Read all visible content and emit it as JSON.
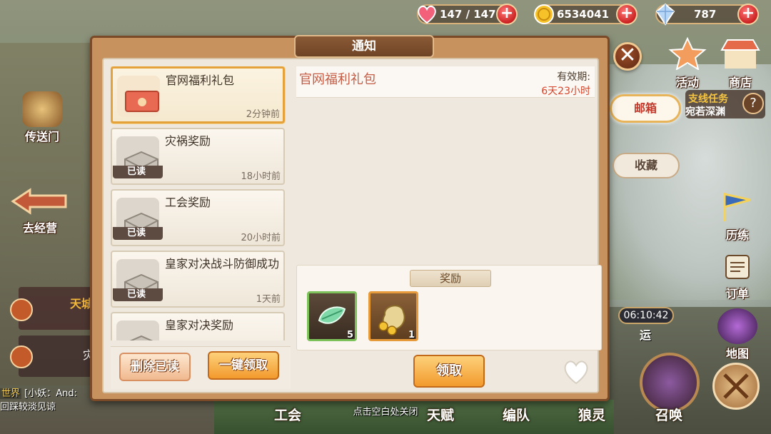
{
  "hud": {
    "stamina": {
      "icon": "heart-icon",
      "value": "147 / 147"
    },
    "gold": {
      "icon": "coin-icon",
      "value": "6534041"
    },
    "crystal": {
      "icon": "crystal-icon",
      "value": "787"
    }
  },
  "left_menu": {
    "portal": "传送门",
    "to_shop": "去经营",
    "banner_top": "天城",
    "banner_bottom": "灾"
  },
  "right_menu": {
    "activity": "活动",
    "shop": "商店",
    "mailbox_tab": "邮箱",
    "favorites_tab": "收藏",
    "branch_quest": "支线任务",
    "branch_sub": "宛若深渊",
    "training": "历练",
    "orders": "订单",
    "map": "地图",
    "timer": "06:10:42",
    "transport": "运"
  },
  "bottom_bar": {
    "guild": "工会",
    "talent": "天赋",
    "team": "编队",
    "spirit": "狼灵",
    "summon": "召唤"
  },
  "chat": {
    "channel": "世界",
    "line1": "[小妖：And:",
    "line2": "回踩较淡见谅"
  },
  "modal": {
    "title": "通知",
    "mails": [
      {
        "title": "官网福利礼包",
        "time": "2分钟前",
        "read": "",
        "selected": true
      },
      {
        "title": "灾祸奖励",
        "time": "18小时前",
        "read": "已读",
        "selected": false
      },
      {
        "title": "工会奖励",
        "time": "20小时前",
        "read": "已读",
        "selected": false
      },
      {
        "title": "皇家对决战斗防御成功",
        "time": "1天前",
        "read": "已读",
        "selected": false
      },
      {
        "title": "皇家对决奖励",
        "time": "",
        "read": "",
        "selected": false
      }
    ],
    "delete_read": "删除已读",
    "claim_all": "一键领取",
    "detail": {
      "title": "官网福利礼包",
      "valid_label": "有效期:",
      "valid_value": "6天23小时"
    },
    "rewards_label": "奖励",
    "rewards": [
      {
        "icon": "leaf-gem-icon",
        "qty": "5"
      },
      {
        "icon": "gold-sack-icon",
        "qty": "1"
      }
    ],
    "claim": "领取"
  },
  "hint": "点击空白处关闭"
}
